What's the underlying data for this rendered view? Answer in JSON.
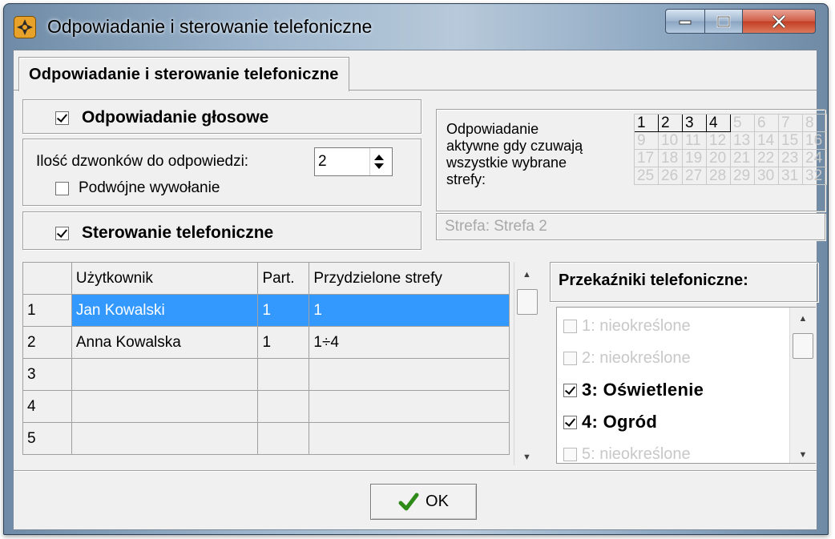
{
  "window": {
    "title": "Odpowiadanie i sterowanie telefoniczne"
  },
  "tab": {
    "label": "Odpowiadanie i sterowanie telefoniczne"
  },
  "voice": {
    "label": "Odpowiadanie głosowe",
    "checked": true
  },
  "rings": {
    "label": "Ilość dzwonków do odpowiedzi:",
    "value": "2"
  },
  "double_call": {
    "label": "Podwójne wywołanie",
    "checked": false
  },
  "phone_control": {
    "label": "Sterowanie telefoniczne",
    "checked": true
  },
  "zones": {
    "desc_line1": "Odpowiadanie",
    "desc_line2": "aktywne gdy czuwają",
    "desc_line3": "wszystkie wybrane",
    "desc_line4": "strefy:",
    "cells": [
      "1",
      "2",
      "3",
      "4",
      "5",
      "6",
      "7",
      "8",
      "9",
      "10",
      "11",
      "12",
      "13",
      "14",
      "15",
      "16",
      "17",
      "18",
      "19",
      "20",
      "21",
      "22",
      "23",
      "24",
      "25",
      "26",
      "27",
      "28",
      "29",
      "30",
      "31",
      "32"
    ],
    "active": [
      "1",
      "2",
      "3",
      "4"
    ],
    "status": "Strefa: Strefa 2"
  },
  "users_table": {
    "headers": [
      "",
      "Użytkownik",
      "Part.",
      "Przydzielone strefy"
    ],
    "rows": [
      [
        "1",
        "Jan Kowalski",
        "1",
        "1"
      ],
      [
        "2",
        "Anna Kowalska",
        "1",
        "1÷4"
      ],
      [
        "3",
        "",
        "",
        ""
      ],
      [
        "4",
        "",
        "",
        ""
      ],
      [
        "5",
        "",
        "",
        ""
      ]
    ],
    "selected_row": 0
  },
  "relays": {
    "title": "Przekaźniki telefoniczne:",
    "items": [
      {
        "label": "1: nieokreślone",
        "checked": false,
        "enabled": false
      },
      {
        "label": "2: nieokreślone",
        "checked": false,
        "enabled": false
      },
      {
        "label": "3: Oświetlenie",
        "checked": true,
        "enabled": true
      },
      {
        "label": "4: Ogród",
        "checked": true,
        "enabled": true
      },
      {
        "label": "5: nieokreślone",
        "checked": false,
        "enabled": false
      }
    ]
  },
  "ok_button": {
    "label": "OK",
    "icon": "checkmark-icon"
  },
  "colors": {
    "selection": "#3399ff",
    "checkmark_green": "#2e8b17",
    "close_red": "#c7432a"
  }
}
